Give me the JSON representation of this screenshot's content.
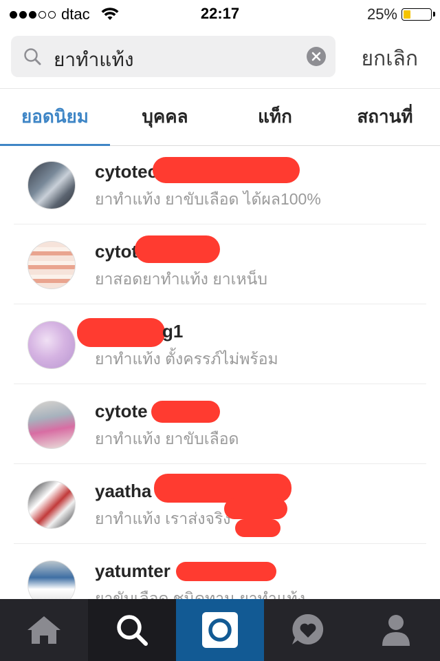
{
  "status_bar": {
    "carrier": "dtac",
    "signal_bars_filled": 3,
    "signal_bars_total": 5,
    "time": "22:17",
    "battery_percent": "25%"
  },
  "search": {
    "query": "ยาทำแท้ง",
    "cancel_label": "ยกเลิก"
  },
  "tabs": [
    {
      "label": "ยอดนิยม",
      "active": true
    },
    {
      "label": "บุคคล",
      "active": false
    },
    {
      "label": "แท็ก",
      "active": false
    },
    {
      "label": "สถานที่",
      "active": false
    }
  ],
  "results": [
    {
      "username": "cytotec_",
      "description": "ยาทำแท้ง ยาขับเลือด ได้ผล100%"
    },
    {
      "username": "cytot",
      "description": "ยาสอดยาทำแท้ง ยาเหน็บ"
    },
    {
      "username": "g1",
      "description": "ยาทำแท้ง ตั้งครรภ์ไม่พร้อม"
    },
    {
      "username": "cytote",
      "description": "ยาทำแท้ง ยาขับเลือด"
    },
    {
      "username": "yaatha",
      "description": "ยาทำแท้ง เราส่งจริง"
    },
    {
      "username": "yatumter",
      "description": "ยาขับเลือด ชนิดทาน ยาทำแท้ง"
    }
  ],
  "colors": {
    "accent": "#3f86c6",
    "redaction": "#ff3b30",
    "tabbar_bg": "#25252a",
    "camera_tab_bg": "#125a94",
    "battery": "#f5c400"
  },
  "bottom_nav": [
    "home-icon",
    "search-icon",
    "camera-icon",
    "activity-heart-icon",
    "profile-icon"
  ]
}
